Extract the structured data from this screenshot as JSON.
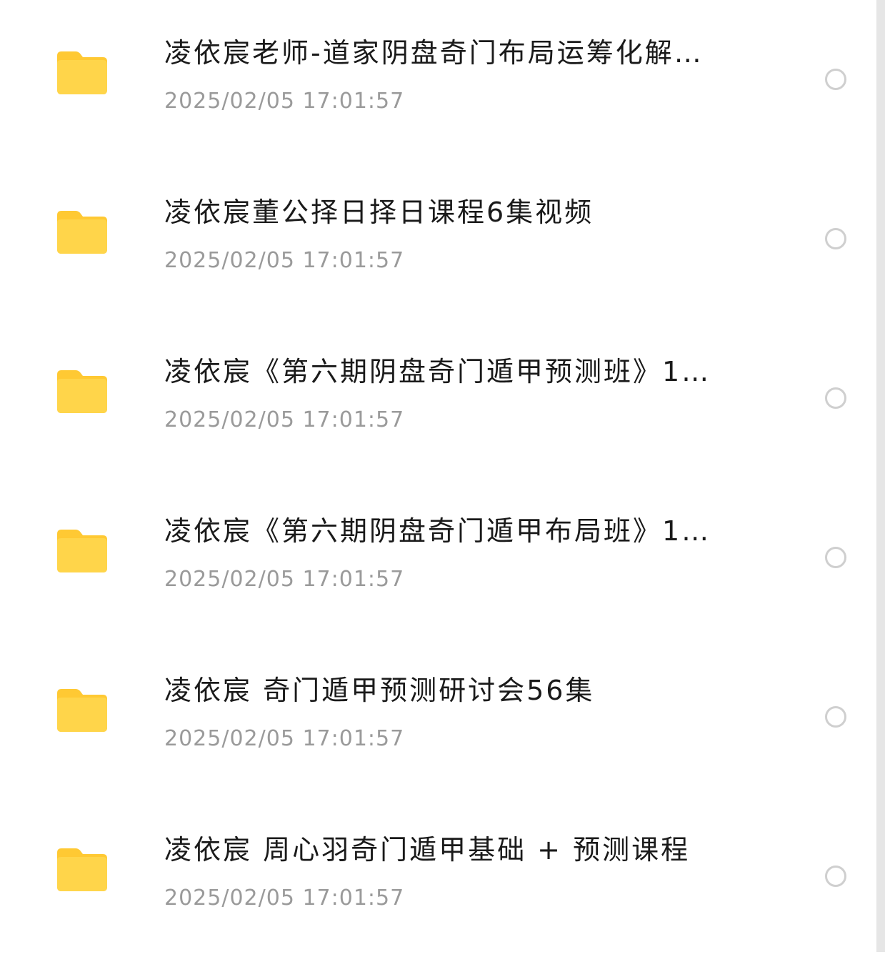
{
  "colors": {
    "folder": "#FFD54A",
    "folder_tab": "#FFC933",
    "title_text": "#1a1a1a",
    "time_text": "#9a9a9a",
    "radio_border": "#cfcfcf",
    "scrollbar": "#e6e6e6"
  },
  "files": [
    {
      "name": "凌依宸老师-道家阴盘奇门布局运筹化解…",
      "time": "2025/02/05 17:01:57",
      "icon": "folder-icon"
    },
    {
      "name": "凌依宸董公择日择日课程6集视频",
      "time": "2025/02/05 17:01:57",
      "icon": "folder-icon"
    },
    {
      "name": "凌依宸《第六期阴盘奇门遁甲预测班》1…",
      "time": "2025/02/05 17:01:57",
      "icon": "folder-icon"
    },
    {
      "name": "凌依宸《第六期阴盘奇门遁甲布局班》1…",
      "time": "2025/02/05 17:01:57",
      "icon": "folder-icon"
    },
    {
      "name": "凌依宸 奇门遁甲预测研讨会56集",
      "time": "2025/02/05 17:01:57",
      "icon": "folder-icon"
    },
    {
      "name": "凌依宸 周心羽奇门遁甲基础 + 预测课程",
      "time": "2025/02/05 17:01:57",
      "icon": "folder-icon"
    }
  ]
}
